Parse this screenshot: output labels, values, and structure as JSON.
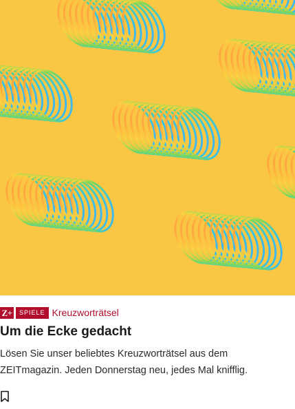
{
  "teaser": {
    "image": {
      "description_icon": "slinky-spring-pattern-image",
      "background_color": "#f9c744"
    },
    "zplus_label": "Z+",
    "section_badge": "Spiele",
    "kicker": "Kreuzworträtsel",
    "headline": "Um die Ecke gedacht",
    "text": "Lösen Sie unser beliebtes Kreuzworträtsel aus dem ZEITmagazin. Jeden Donnerstag neu, jedes Mal knifflig.",
    "bookmark_icon": "bookmark-icon",
    "accent_color": "#b10d2c"
  }
}
